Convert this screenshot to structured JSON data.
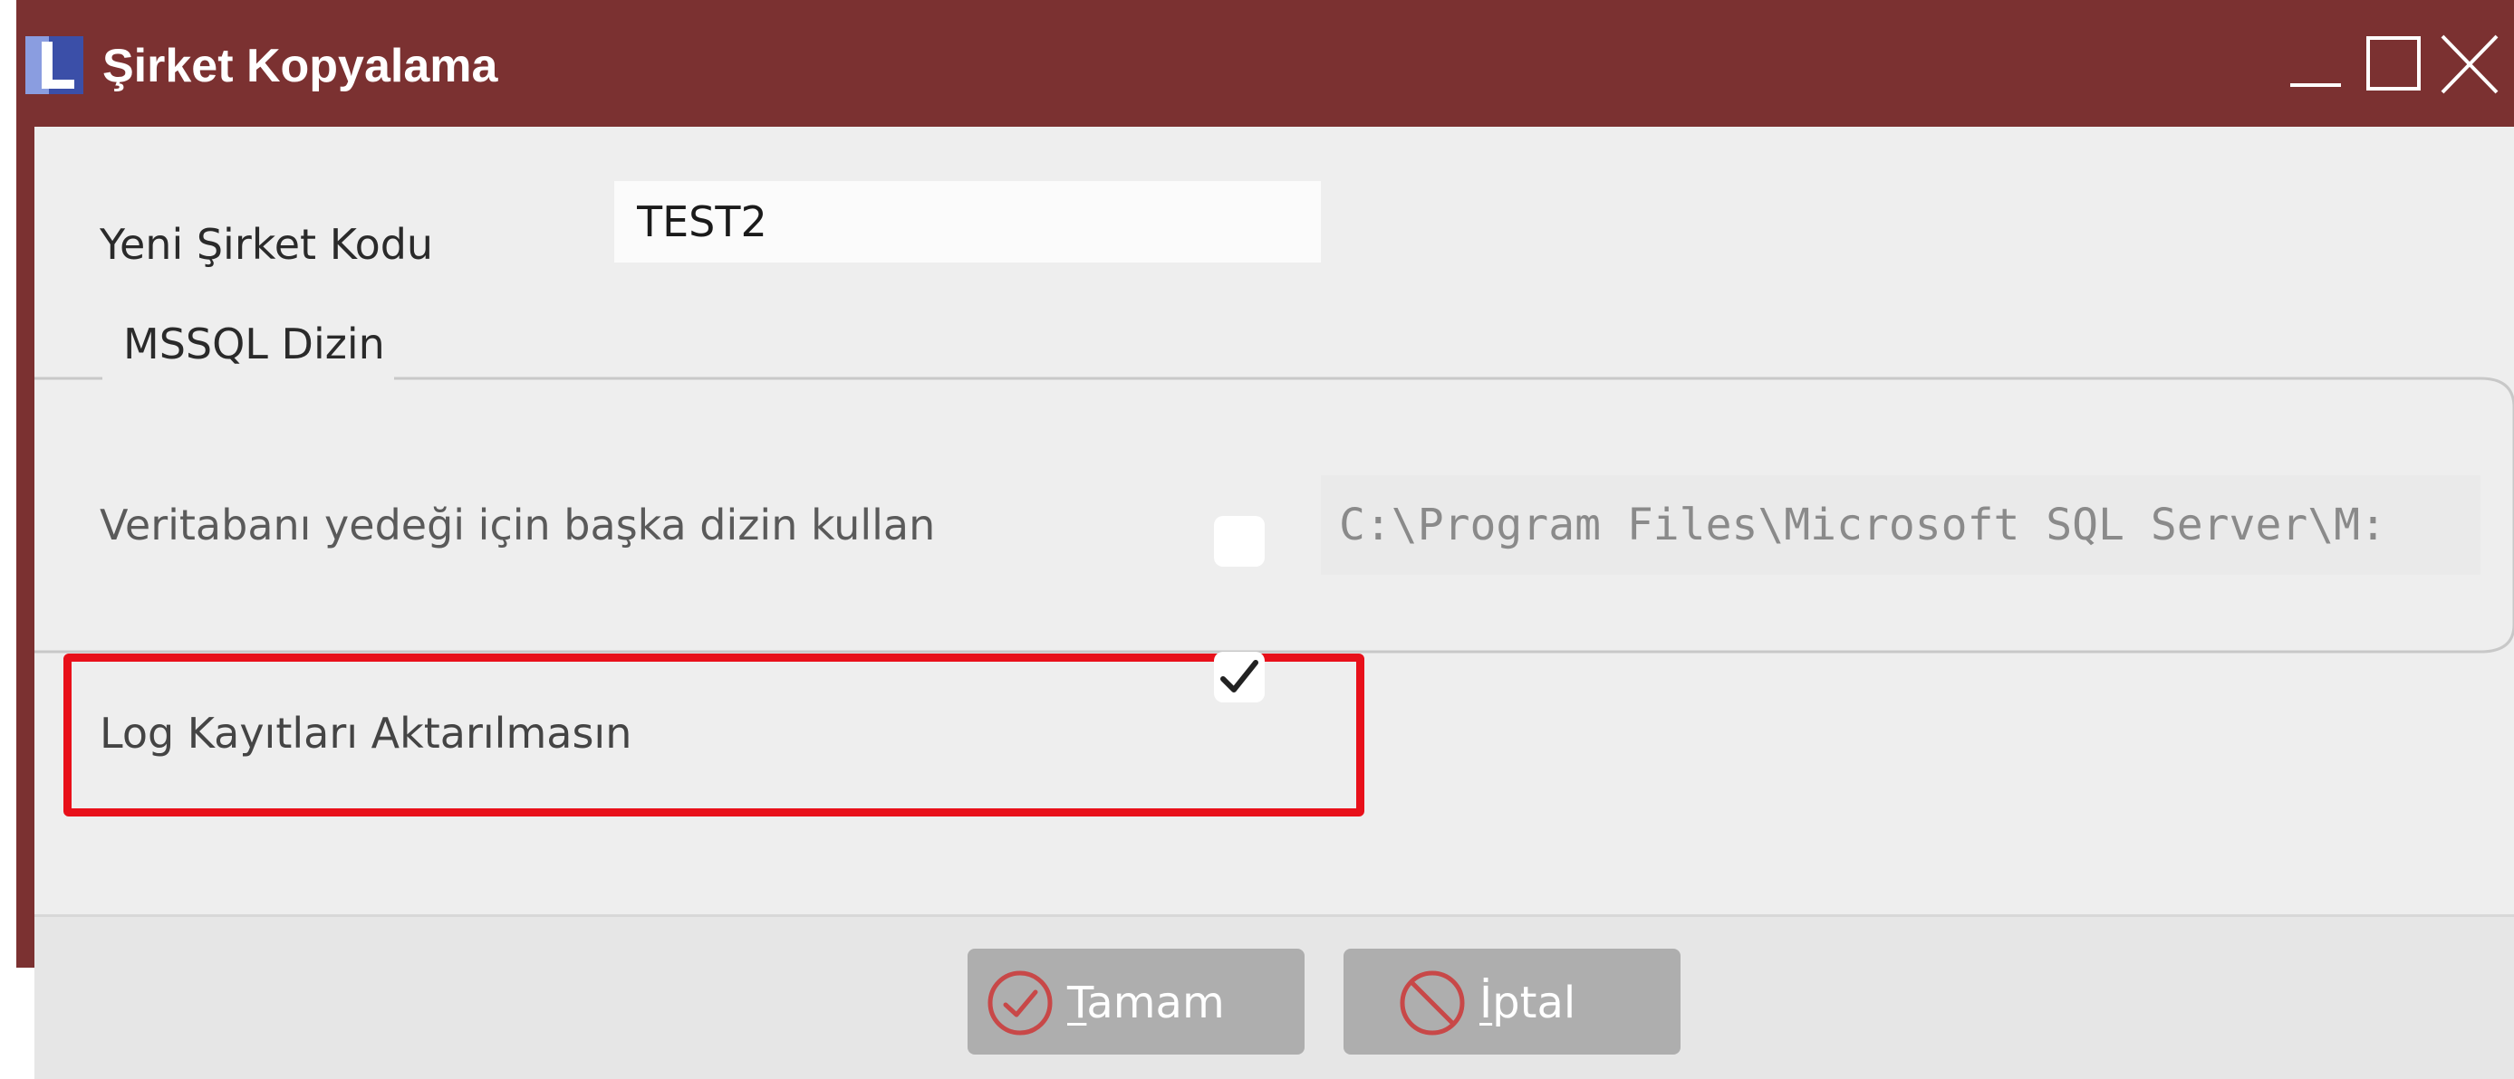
{
  "window": {
    "title": "Şirket Kopyalama",
    "title_bar_color": "#7b3131",
    "logo_letter": "L",
    "controls": [
      "minimize",
      "maximize",
      "close"
    ]
  },
  "form": {
    "company_code_label": "Yeni Şirket Kodu",
    "company_code_value": "TEST2",
    "mssql_group": {
      "legend": "MSSQL Dizin",
      "backup_dir_label": "Veritabanı yedeği için başka dizin kullan",
      "backup_dir_checked": false,
      "backup_dir_path": "C:\\Program Files\\Microsoft SQL Server\\M:"
    },
    "log_label": "Log Kayıtları Aktarılmasın",
    "log_checked": true,
    "highlight_color": "#e8101a"
  },
  "buttons": {
    "ok": {
      "mnemonic": "T",
      "rest": "amam",
      "icon": "check-circle-icon"
    },
    "cancel": {
      "mnemonic": "İ",
      "rest": "ptal",
      "icon": "prohibited-icon"
    }
  }
}
